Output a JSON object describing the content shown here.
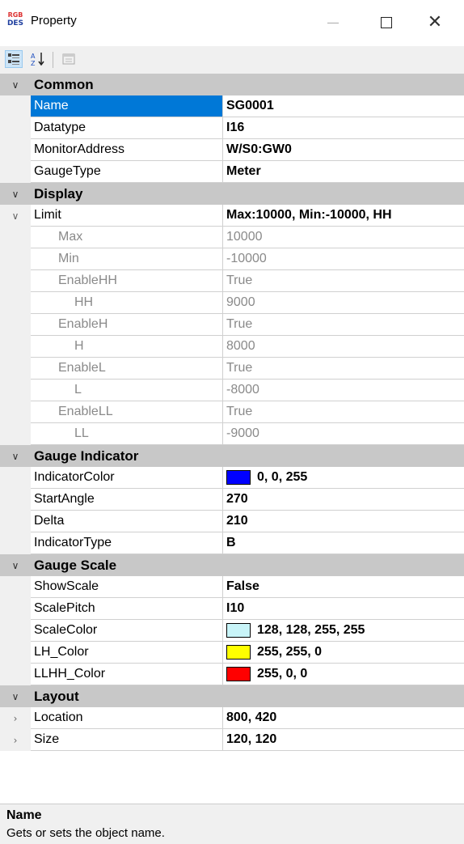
{
  "window": {
    "title": "Property",
    "icon_text_top": "RGB",
    "icon_text_bottom": "DES"
  },
  "toolbar": {
    "categorized": "categorized-icon",
    "alphabetical": "A↓Z",
    "property_pages": "property-pages-icon"
  },
  "categories": {
    "common": "Common",
    "display": "Display",
    "gauge_indicator": "Gauge Indicator",
    "gauge_scale": "Gauge Scale",
    "layout": "Layout"
  },
  "props": {
    "name": {
      "label": "Name",
      "value": "SG0001"
    },
    "datatype": {
      "label": "Datatype",
      "value": "I16"
    },
    "monitor_address": {
      "label": "MonitorAddress",
      "value": "W/S0:GW0"
    },
    "gauge_type": {
      "label": "GaugeType",
      "value": "Meter"
    },
    "limit": {
      "label": "Limit",
      "value": "Max:10000, Min:-10000, HH"
    },
    "max": {
      "label": "Max",
      "value": "10000"
    },
    "min": {
      "label": "Min",
      "value": "-10000"
    },
    "enable_hh": {
      "label": "EnableHH",
      "value": "True"
    },
    "hh": {
      "label": "HH",
      "value": "9000"
    },
    "enable_h": {
      "label": "EnableH",
      "value": "True"
    },
    "h": {
      "label": "H",
      "value": "8000"
    },
    "enable_l": {
      "label": "EnableL",
      "value": "True"
    },
    "l": {
      "label": "L",
      "value": "-8000"
    },
    "enable_ll": {
      "label": "EnableLL",
      "value": "True"
    },
    "ll": {
      "label": "LL",
      "value": "-9000"
    },
    "indicator_color": {
      "label": "IndicatorColor",
      "value": "0, 0, 255",
      "color": "#0000ff"
    },
    "start_angle": {
      "label": "StartAngle",
      "value": "270"
    },
    "delta": {
      "label": "Delta",
      "value": "210"
    },
    "indicator_type": {
      "label": "IndicatorType",
      "value": "B"
    },
    "show_scale": {
      "label": "ShowScale",
      "value": "False"
    },
    "scale_pitch": {
      "label": "ScalePitch",
      "value": "I10"
    },
    "scale_color": {
      "label": "ScaleColor",
      "value": "128, 128, 255, 255",
      "color": "#c8f4f8"
    },
    "lh_color": {
      "label": "LH_Color",
      "value": "255, 255, 0",
      "color": "#ffff00"
    },
    "llhh_color": {
      "label": "LLHH_Color",
      "value": "255, 0, 0",
      "color": "#ff0000"
    },
    "location": {
      "label": "Location",
      "value": "800, 420"
    },
    "size": {
      "label": "Size",
      "value": "120, 120"
    }
  },
  "help": {
    "title": "Name",
    "description": "Gets or sets the object name."
  }
}
